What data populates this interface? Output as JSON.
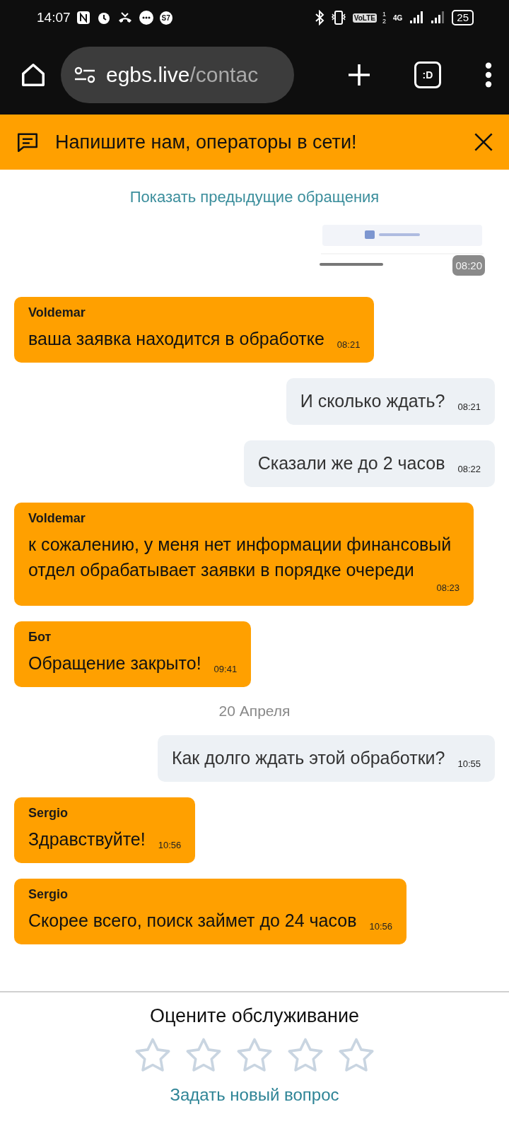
{
  "status_bar": {
    "time": "14:07",
    "badge": "S7",
    "volte": "VoLTE",
    "sims": [
      "1",
      "2"
    ],
    "network": "4G",
    "battery": "25"
  },
  "browser": {
    "url_host": "egbs.live",
    "url_path": "/contac",
    "tabs_label": ":D"
  },
  "banner": {
    "text": "Напишите нам, операторы в сети!"
  },
  "history_link": "Показать предыдущие обращения",
  "messages": [
    {
      "time": "08:20"
    },
    {
      "kind": "operator",
      "author": "Voldemar",
      "text": "ваша заявка находится в обработке",
      "time": "08:21"
    },
    {
      "kind": "user",
      "text": "И сколько ждать?",
      "time": "08:21"
    },
    {
      "kind": "user",
      "text": "Сказали же до 2 часов",
      "time": "08:22"
    },
    {
      "kind": "operator",
      "author": "Voldemar",
      "text": "к сожалению, у меня нет информации финансовый отдел обрабатывает заявки в порядке очереди",
      "time": "08:23"
    },
    {
      "kind": "operator",
      "author": "Бот",
      "text": "Обращение закрыто!",
      "time": "09:41"
    },
    {
      "kind": "date",
      "text": "20 Апреля"
    },
    {
      "kind": "user",
      "text": "Как долго ждать этой обработки?",
      "time": "10:55"
    },
    {
      "kind": "operator",
      "author": "Sergio",
      "text": "Здравствуйте!",
      "time": "10:56"
    },
    {
      "kind": "operator",
      "author": "Sergio",
      "text": "Скорее всего, поиск займет до 24 часов",
      "time": "10:56"
    }
  ],
  "rating": {
    "title": "Оцените обслуживание",
    "stars": 0,
    "link": "Задать новый вопрос"
  }
}
